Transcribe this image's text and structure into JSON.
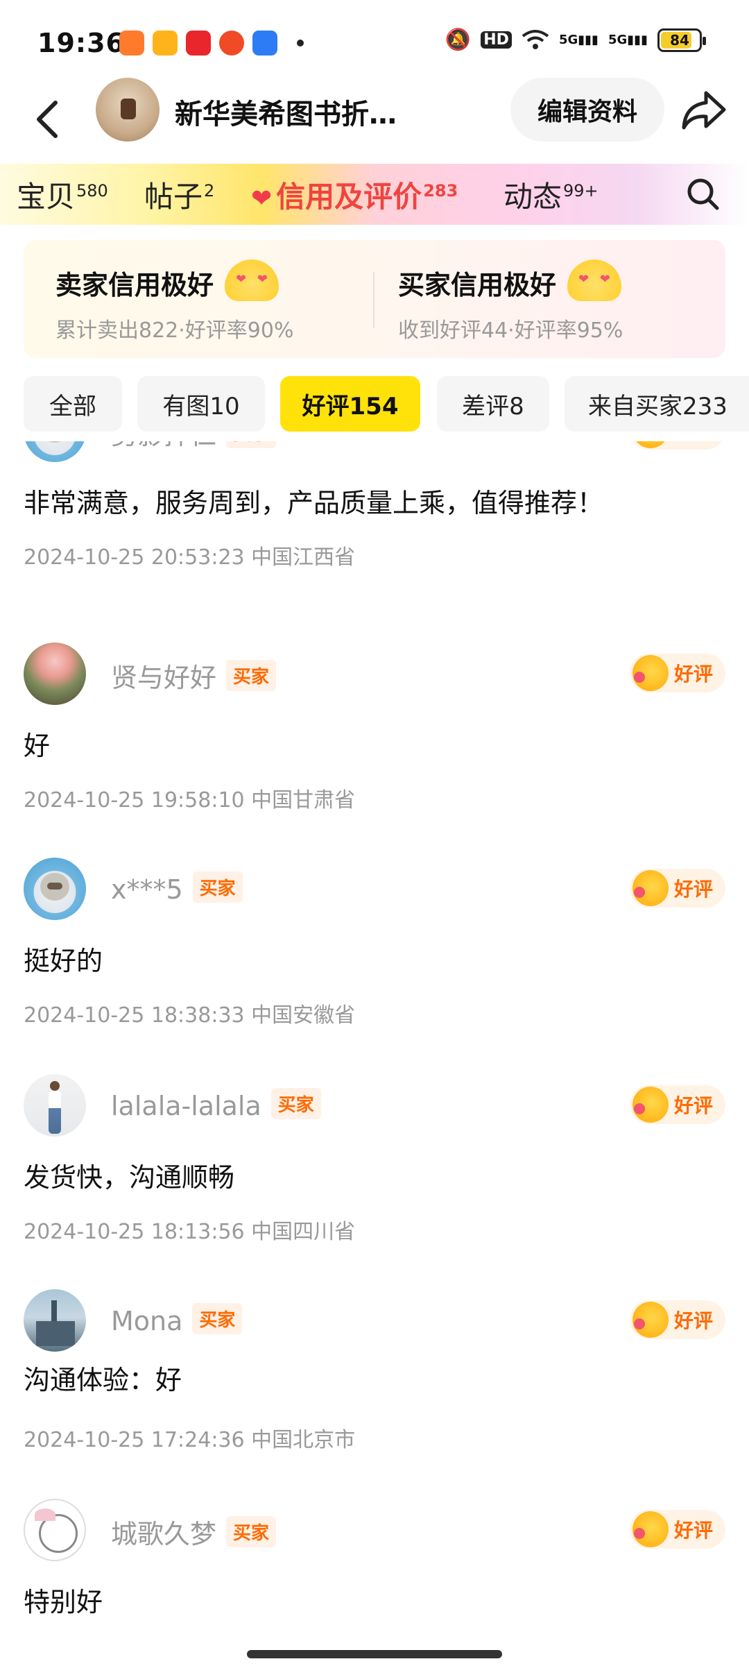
{
  "status_bar": {
    "time": "19:36",
    "battery": "84",
    "network_labels": [
      "5G",
      "5G"
    ]
  },
  "header": {
    "back_icon": "chevron-left-icon",
    "shop_name": "新华美希图书折…",
    "edit_label": "编辑资料",
    "share_icon": "share-arrow-icon"
  },
  "tabs": [
    {
      "label": "宝贝",
      "count": "580"
    },
    {
      "label": "帖子",
      "count": "2"
    },
    {
      "label": "信用及评价",
      "count": "283"
    },
    {
      "label": "动态",
      "count": "99+"
    }
  ],
  "credit": {
    "seller": {
      "title": "卖家信用极好",
      "sub": "累计卖出822·好评率90%"
    },
    "buyer": {
      "title": "买家信用极好",
      "sub": "收到好评44·好评率95%"
    }
  },
  "filters": [
    {
      "label": "全部"
    },
    {
      "label": "有图10"
    },
    {
      "label": "好评154"
    },
    {
      "label": "差评8"
    },
    {
      "label": "来自买家233"
    }
  ],
  "reviews": [
    {
      "name": "剪影拌仁",
      "tag": "买家",
      "rating": "好评",
      "text": "非常满意，服务周到，产品质量上乘，值得推荐！",
      "time": "2024-10-25 20:53:23",
      "location": "中国江西省"
    },
    {
      "name": "贤与好好",
      "tag": "买家",
      "rating": "好评",
      "text": "好",
      "time": "2024-10-25 19:58:10",
      "location": "中国甘肃省"
    },
    {
      "name": "x***5",
      "tag": "买家",
      "rating": "好评",
      "text": "挺好的",
      "time": "2024-10-25 18:38:33",
      "location": "中国安徽省"
    },
    {
      "name": "lalala-lalala",
      "tag": "买家",
      "rating": "好评",
      "text": "发货快，沟通顺畅",
      "time": "2024-10-25 18:13:56",
      "location": "中国四川省"
    },
    {
      "name": "Mona",
      "tag": "买家",
      "rating": "好评",
      "text": "沟通体验：好",
      "time": "2024-10-25 17:24:36",
      "location": "中国北京市"
    },
    {
      "name": "城歌久梦",
      "tag": "买家",
      "rating": "好评",
      "text": "特别好",
      "time": "",
      "location": ""
    }
  ]
}
